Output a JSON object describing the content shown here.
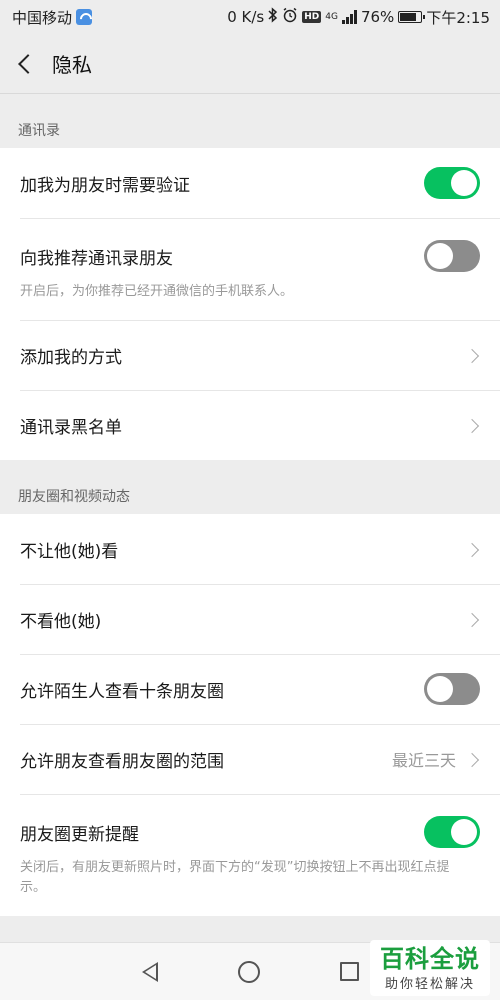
{
  "status_bar": {
    "carrier": "中国移动",
    "speed": "0 K/s",
    "hd": "HD",
    "network": "4G",
    "battery": "76%",
    "battery_level": 0.76,
    "time": "下午2:15"
  },
  "nav": {
    "title": "隐私"
  },
  "sections": [
    {
      "header": "通讯录",
      "rows": [
        {
          "label": "加我为朋友时需要验证",
          "toggle": "on"
        },
        {
          "label": "向我推荐通讯录朋友",
          "toggle": "off",
          "desc": "开启后，为你推荐已经开通微信的手机联系人。"
        },
        {
          "label": "添加我的方式"
        },
        {
          "label": "通讯录黑名单"
        }
      ]
    },
    {
      "header": "朋友圈和视频动态",
      "rows": [
        {
          "label": "不让他(她)看"
        },
        {
          "label": "不看他(她)"
        },
        {
          "label": "允许陌生人查看十条朋友圈",
          "toggle": "off"
        },
        {
          "label": "允许朋友查看朋友圈的范围",
          "value": "最近三天"
        },
        {
          "label": "朋友圈更新提醒",
          "toggle": "on",
          "desc": "关闭后，有朋友更新照片时，界面下方的“发现”切换按钮上不再出现红点提示。"
        }
      ]
    }
  ],
  "watermark": {
    "title": "百科全说",
    "subtitle": "助你轻松解决"
  },
  "colors": {
    "toggle_on": "#07c160",
    "toggle_off": "#8c8c8c",
    "watermark": "#1b9e3e"
  },
  "icons": [
    "back-icon",
    "chevron-right-icon",
    "bluetooth-icon",
    "alarm-icon",
    "signal-icon",
    "battery-icon",
    "nav-back-icon",
    "nav-home-icon",
    "nav-recent-icon"
  ]
}
